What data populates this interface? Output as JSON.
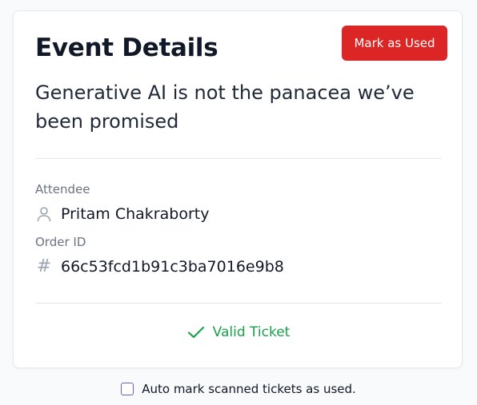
{
  "card": {
    "heading": "Event Details",
    "mark_button_label": "Mark as Used",
    "event_title": "Generative AI is not the panacea we’ve been promised",
    "attendee_label": "Attendee",
    "attendee_name": "Pritam Chakraborty",
    "attendee_icon": "user-icon",
    "order_label": "Order ID",
    "order_id": "66c53fcd1b91c3ba7016e9b8",
    "order_icon": "hash-icon",
    "status_text": "Valid Ticket",
    "status_icon": "check-icon"
  },
  "footer": {
    "auto_mark_label": "Auto mark scanned tickets as used.",
    "auto_mark_checked": false
  },
  "colors": {
    "danger": "#dc2626",
    "success": "#16a34a",
    "checkbox_border": "#6d5dd3"
  }
}
